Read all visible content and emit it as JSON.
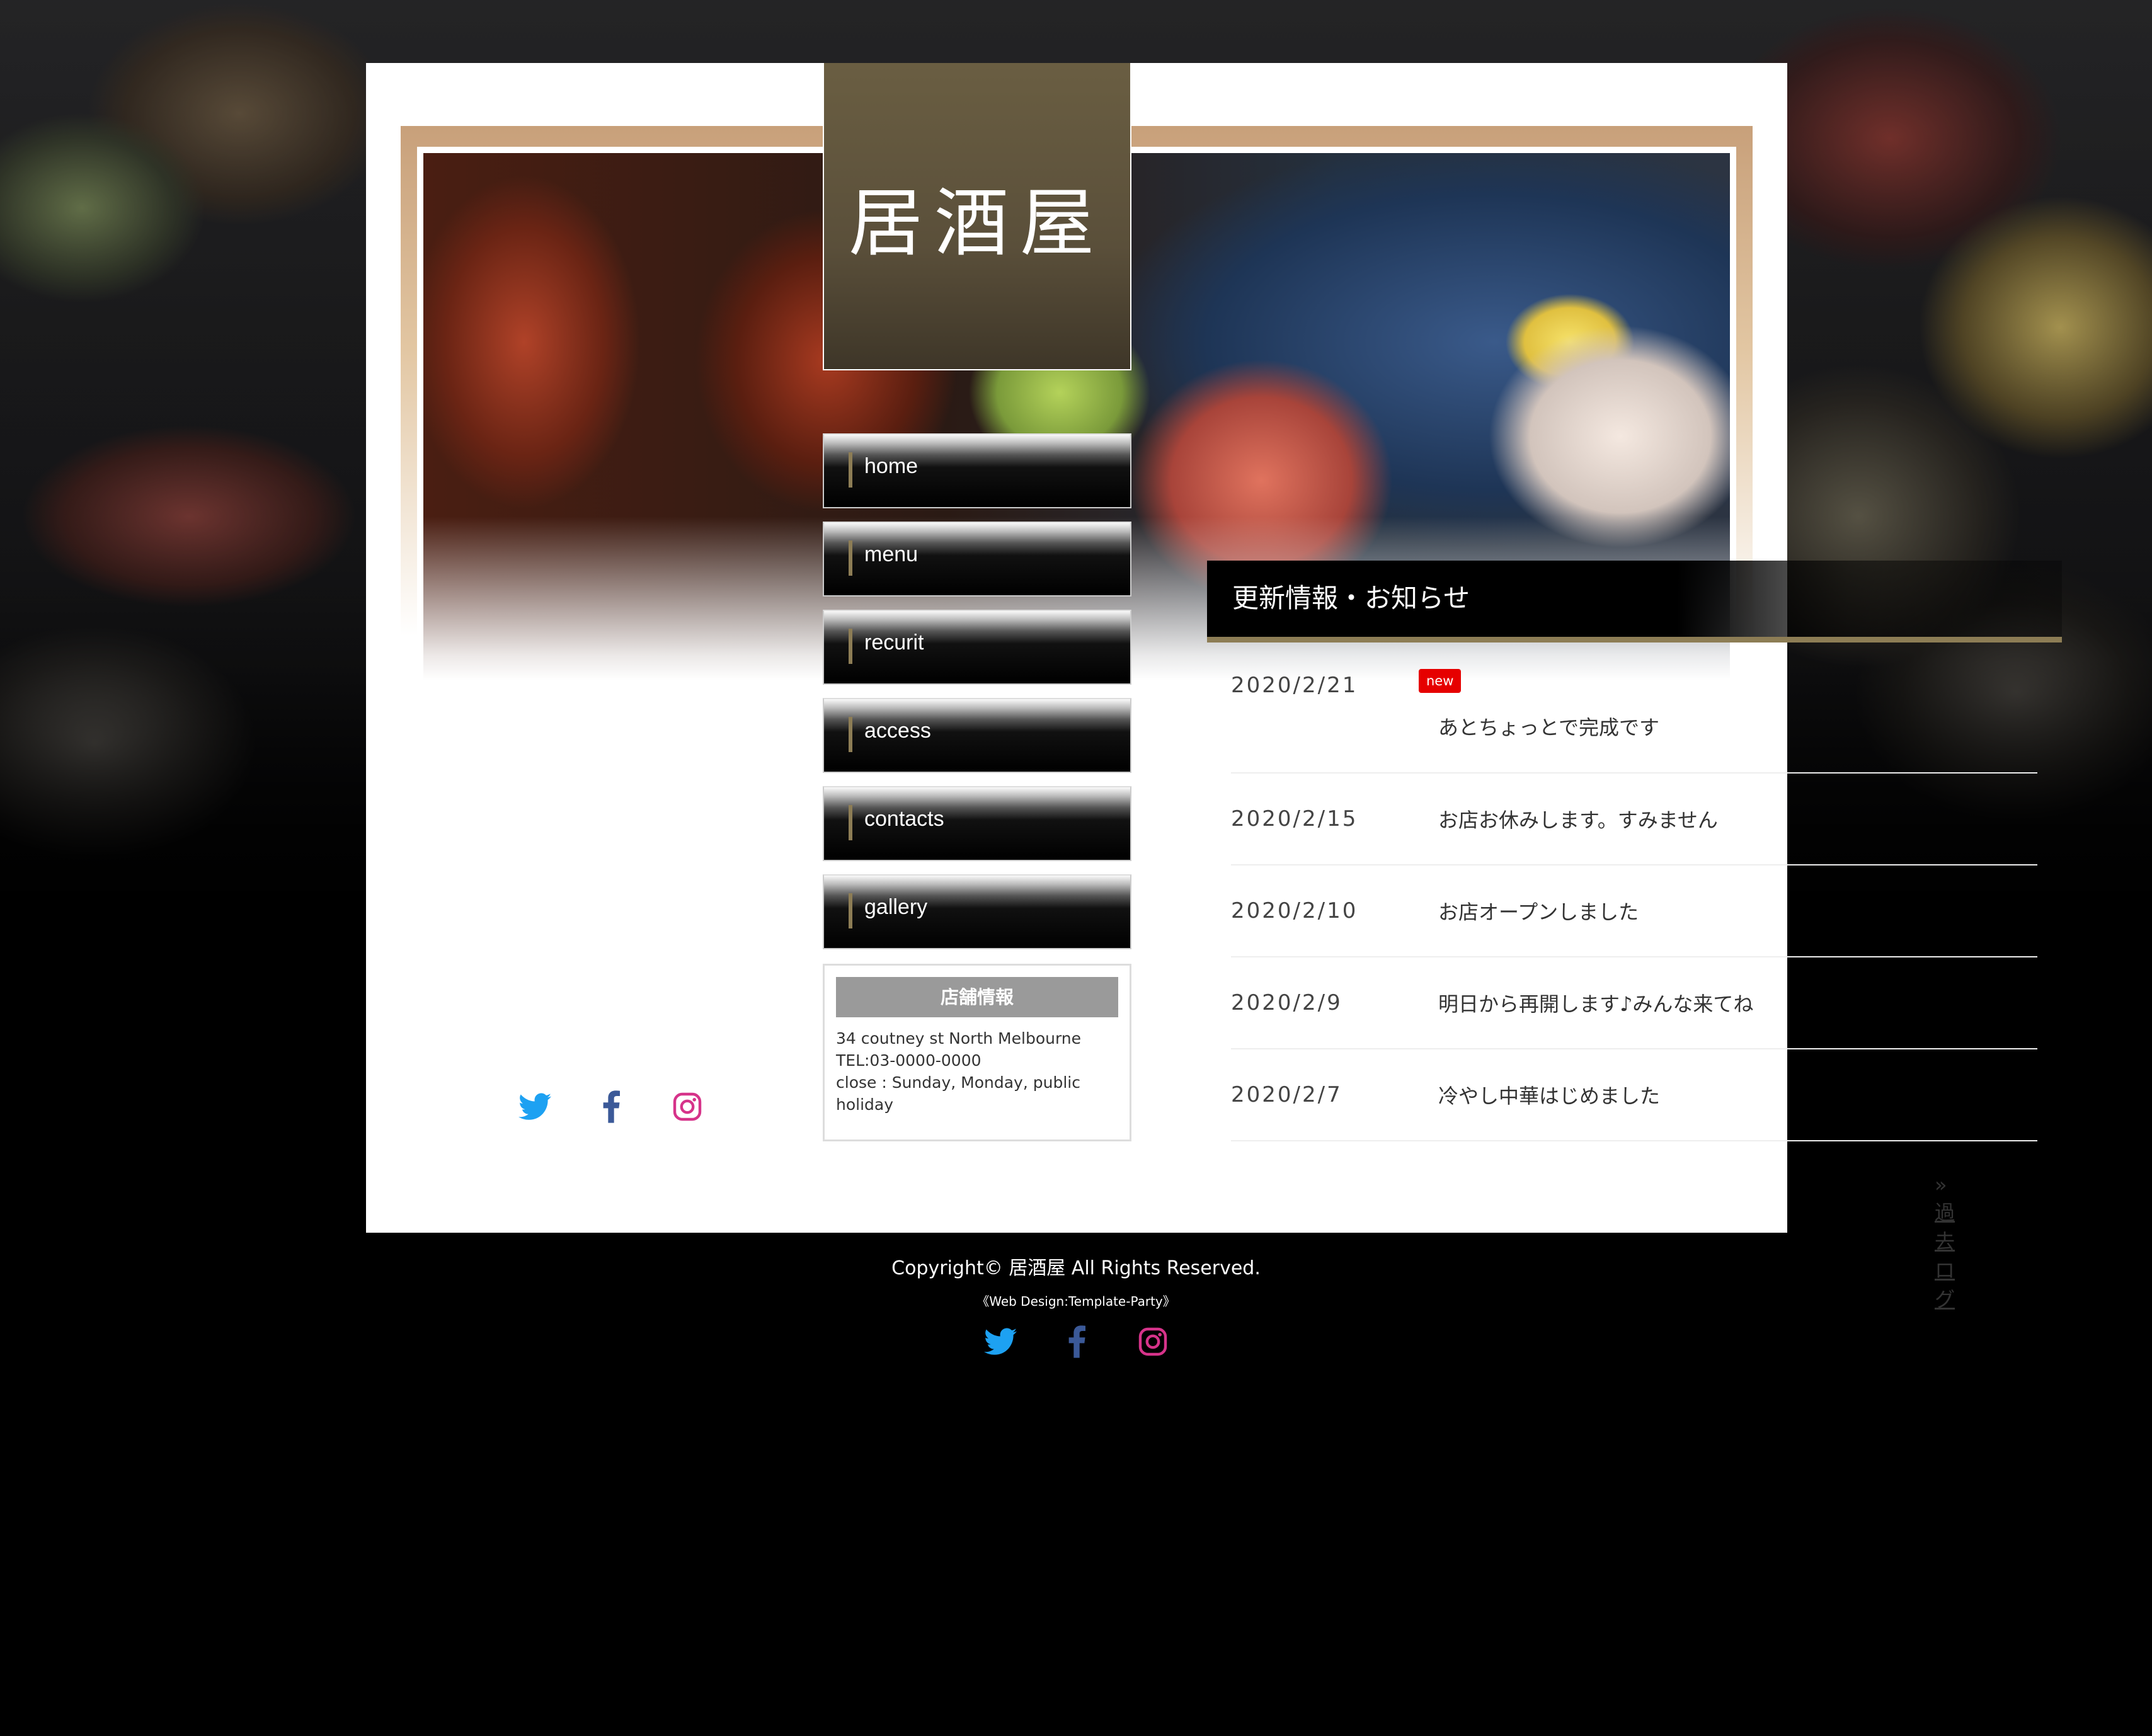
{
  "site": {
    "logo_text": "居酒屋"
  },
  "menu": {
    "items": [
      {
        "label": "home"
      },
      {
        "label": "menu"
      },
      {
        "label": "recurit"
      },
      {
        "label": "access"
      },
      {
        "label": "contacts"
      },
      {
        "label": "gallery"
      }
    ]
  },
  "shop_info": {
    "heading": "店舗情報",
    "address": "34 coutney st North Melbourne",
    "tel": "TEL:03-0000-0000",
    "close": "close : Sunday, Monday, public",
    "close_cont": "holiday"
  },
  "sns": {
    "icons": [
      "twitter-icon",
      "facebook-icon",
      "instagram-icon"
    ],
    "colors": {
      "twitter": "#1da1f2",
      "facebook": "#3b5998",
      "instagram": "#d6338a"
    }
  },
  "news": {
    "heading": "更新情報・お知らせ",
    "new_badge": "new",
    "items": [
      {
        "date": "2020/2/21",
        "text": "あとちょっとで完成です",
        "is_new": true
      },
      {
        "date": "2020/2/15",
        "text": "お店お休みします。すみません"
      },
      {
        "date": "2020/2/10",
        "text": "お店オープンしました"
      },
      {
        "date": "2020/2/9",
        "text": "明日から再開します♪みんな来てね"
      },
      {
        "date": "2020/2/7",
        "text": "冷やし中華はじめました"
      }
    ],
    "past_log_prefix": "»",
    "past_log_label": "過去ログ"
  },
  "footer": {
    "copyright": "Copyright© 居酒屋 All Rights Reserved.",
    "design_credit": "《Web Design:Template-Party》"
  },
  "colors": {
    "accent": "#8d7d55",
    "new_badge": "#e60000",
    "logo_bg": "#5a4f3a"
  }
}
